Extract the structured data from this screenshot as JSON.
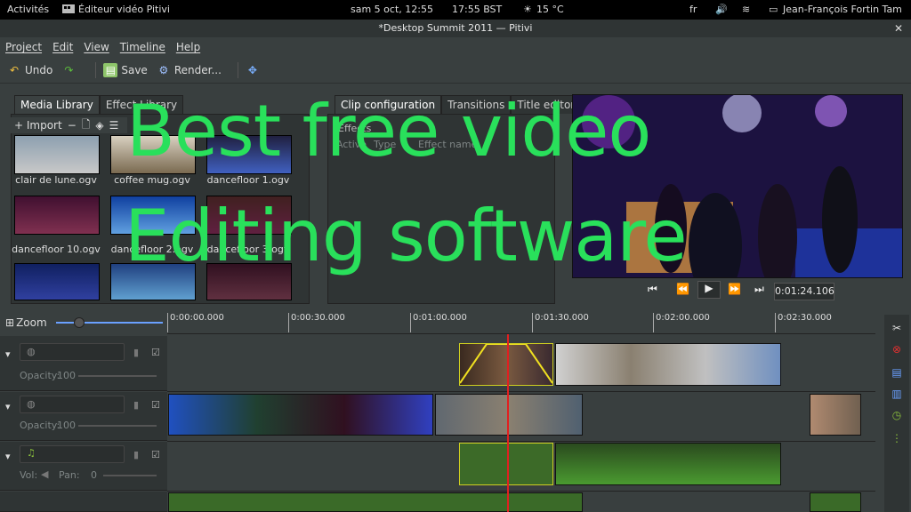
{
  "topbar": {
    "activities": "Activités",
    "app_name": "Éditeur vidéo Pitivi",
    "datetime": "sam  5 oct, 12:55",
    "bst": "17:55 BST",
    "weather": "15 °C",
    "lang": "fr",
    "user": "Jean-François Fortin Tam"
  },
  "window": {
    "title": "*Desktop Summit 2011 — Pitivi"
  },
  "menu": [
    "Project",
    "Edit",
    "View",
    "Timeline",
    "Help"
  ],
  "toolbar": {
    "undo": "Undo",
    "save": "Save",
    "render": "Render..."
  },
  "media_tabs": [
    "Media Library",
    "Effect Library"
  ],
  "media_toolbar": {
    "import": "+ Import"
  },
  "media_items": [
    {
      "label": "clair de lune.ogv"
    },
    {
      "label": "coffee mug.ogv"
    },
    {
      "label": "dancefloor 1.ogv"
    },
    {
      "label": "dancefloor 10.ogv"
    },
    {
      "label": "dancefloor 2.ogv"
    },
    {
      "label": "dancefloor 3.ogv"
    },
    {
      "label": ""
    },
    {
      "label": ""
    },
    {
      "label": ""
    }
  ],
  "clip_tabs": [
    "Clip configuration",
    "Transitions",
    "Title editor"
  ],
  "clip_config": {
    "effects_header": "Effects",
    "col_active": "Active",
    "col_type": "Type",
    "col_effect": "Effect name"
  },
  "viewer": {
    "timecode": "0:01:24.106"
  },
  "timeline": {
    "zoom_label": "Zoom",
    "ruler_labels": [
      "0:00:00.000",
      "0:00:30.000",
      "0:01:00.000",
      "0:01:30.000",
      "0:02:00.000",
      "0:02:30.000"
    ],
    "tracks": [
      {
        "kind": "video",
        "opacity_label": "Opacity:",
        "opacity_value": "100"
      },
      {
        "kind": "video",
        "opacity_label": "Opacity:",
        "opacity_value": "100"
      },
      {
        "kind": "audio",
        "vol_label": "Vol:",
        "pan_label": "Pan:",
        "pan_value": "0"
      }
    ]
  },
  "overlay": {
    "line1": "Best free video",
    "line2": "Editing software"
  },
  "colors": {
    "accent_green": "#29e05b",
    "playhead": "#e02020",
    "bg": "#393f3f"
  }
}
